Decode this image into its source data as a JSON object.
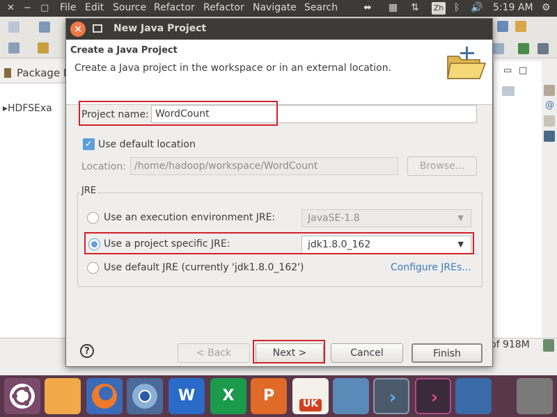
{
  "menubar": {
    "items": [
      "File",
      "Edit",
      "Source",
      "Refactor",
      "Refactor",
      "Navigate",
      "Search"
    ],
    "ime": "Zh",
    "clock": "5:19 AM"
  },
  "package_explorer": {
    "tab_label": "Package E",
    "tree_item": "HDFSExa"
  },
  "status": {
    "memory": "of 918M"
  },
  "dialog": {
    "title": "New Java Project",
    "header_title": "Create a Java Project",
    "header_description": "Create a Java project in the workspace or in an external location.",
    "project_name_label": "Project name:",
    "project_name_value": "WordCount",
    "use_default_location_label": "Use default location",
    "use_default_location_checked": true,
    "location_label": "Location:",
    "location_value": "/home/hadoop/workspace/WordCount",
    "browse_label": "Browse...",
    "jre_group_label": "JRE",
    "jre_options": {
      "execution_env_label": "Use an execution environment JRE:",
      "execution_env_value": "JavaSE-1.8",
      "project_specific_label": "Use a project specific JRE:",
      "project_specific_value": "jdk1.8.0_162",
      "default_label": "Use default JRE (currently 'jdk1.8.0_162')",
      "selected": "project_specific"
    },
    "configure_jres_label": "Configure JREs...",
    "buttons": {
      "help": "?",
      "back": "< Back",
      "next": "Next >",
      "cancel": "Cancel",
      "finish": "Finish"
    },
    "highlight_color": "#d42028",
    "accent_color": "#5f9ed8"
  },
  "launcher": {
    "apps": [
      "ubuntu-dash",
      "files",
      "firefox",
      "chromium",
      "wps-writer",
      "wps-spreadsheets",
      "wps-presentation",
      "ubuntu-software-uk",
      "remmina",
      "terminal",
      "terminal-active",
      "workspace-switcher",
      "trash"
    ],
    "writer_glyph": "W",
    "spreadsheets_glyph": "X",
    "presentation_glyph": "P",
    "software_label": "UK"
  }
}
